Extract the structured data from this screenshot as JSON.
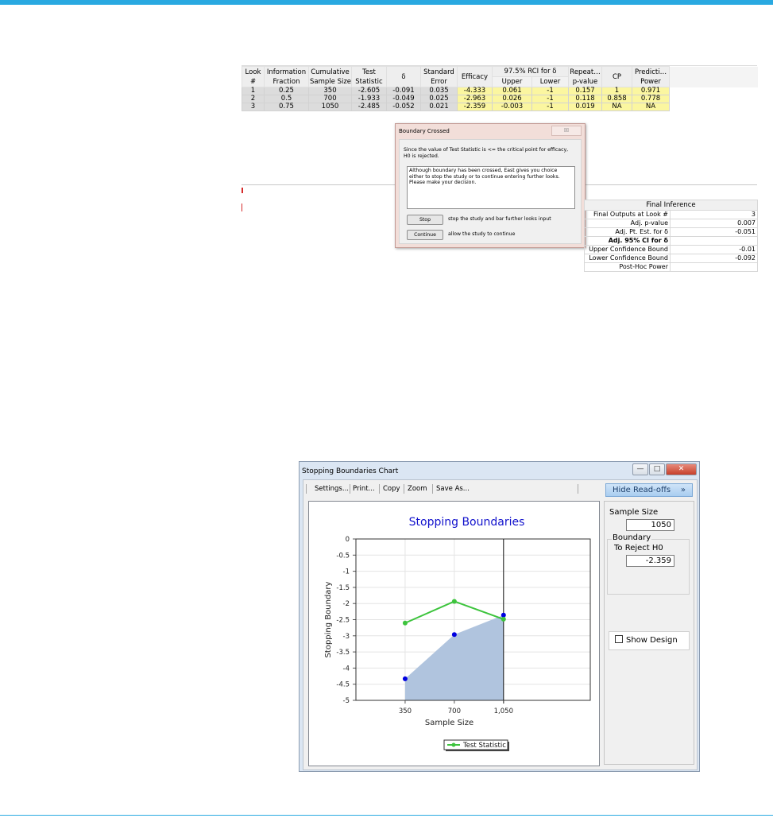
{
  "results": {
    "headers": [
      "Look #",
      "Information Fraction",
      "Cumulative Sample Size",
      "Test Statistic",
      "δ",
      "Standard Error",
      "Efficacy",
      "97.5% RCI for δ",
      "Repeat… p-value",
      "CP",
      "Predicti… Power"
    ],
    "header_lines": {
      "look": [
        "Look",
        "#"
      ],
      "info": [
        "Information",
        "Fraction"
      ],
      "cum": [
        "Cumulative",
        "Sample Size"
      ],
      "test": [
        "Test",
        "Statistic"
      ],
      "delta": "δ",
      "se": [
        "Standard",
        "Error"
      ],
      "eff": "Efficacy",
      "rci": "97.5% RCI for δ",
      "rci_upper": "Upper",
      "rci_lower": "Lower",
      "rep": [
        "Repeat…",
        "p-value"
      ],
      "cp": "CP",
      "pred": [
        "Predicti…",
        "Power"
      ]
    },
    "rows": [
      [
        "1",
        "0.25",
        "350",
        "-2.605",
        "-0.091",
        "0.035",
        "-4.333",
        "0.061",
        "-1",
        "0.157",
        "1",
        "0.971"
      ],
      [
        "2",
        "0.5",
        "700",
        "-1.933",
        "-0.049",
        "0.025",
        "-2.963",
        "0.026",
        "-1",
        "0.118",
        "0.858",
        "0.778"
      ],
      [
        "3",
        "0.75",
        "1050",
        "-2.485",
        "-0.052",
        "0.021",
        "-2.359",
        "-0.003",
        "-1",
        "0.019",
        "NA",
        "NA"
      ]
    ]
  },
  "dialog": {
    "title": "Boundary Crossed",
    "close": "☒",
    "message": "Since the value of Test Statistic is <= the critical point for efficacy, H0 is rejected.",
    "note": "Although boundary has been crossed, East gives you choice either to stop the study or to continue entering further looks. Please make your decision.",
    "stop_label": "Stop",
    "stop_desc": "stop the study and bar further looks input",
    "continue_label": "Continue",
    "continue_desc": "allow the study to continue"
  },
  "final_inference": {
    "title": "Final Inference",
    "rows": [
      {
        "label": "Final Outputs at Look #",
        "value": "3"
      },
      {
        "label": "Adj. p-value",
        "value": "0.007"
      },
      {
        "label": "Adj. Pt. Est. for δ",
        "value": "-0.051"
      },
      {
        "label": "Adj. 95% CI for δ",
        "value": ""
      },
      {
        "label": "Upper Confidence Bound",
        "value": "-0.01"
      },
      {
        "label": "Lower Confidence Bound",
        "value": "-0.092"
      },
      {
        "label": "Post-Hoc Power",
        "value": ""
      }
    ]
  },
  "chart_window": {
    "title": "Stopping Boundaries Chart",
    "toolbar": [
      "Settings...",
      "Print...",
      "Copy",
      "Zoom",
      "Save As..."
    ],
    "hide_readoffs": "Hide Read-offs",
    "hide_chevron": "»",
    "sample_size_label": "Sample Size",
    "sample_size_value": "1050",
    "boundary_group": "Boundary",
    "boundary_label": "To Reject H0",
    "boundary_value": "-2.359",
    "show_design": "Show Design",
    "minimize": "—",
    "maximize": "□",
    "close": "✕"
  },
  "chart_data": {
    "type": "line",
    "title": "Stopping Boundaries",
    "xlabel": "Sample Size",
    "ylabel": "Stopping Boundary",
    "x_ticks": [
      "350",
      "700",
      "1,050"
    ],
    "x_tick_values": [
      350,
      700,
      1050
    ],
    "y_ticks": [
      "0",
      "-0.5",
      "-1",
      "-1.5",
      "-2",
      "-2.5",
      "-3",
      "-3.5",
      "-4",
      "-4.5",
      "-5"
    ],
    "ylim": [
      -5,
      0
    ],
    "xlim": [
      0,
      1667
    ],
    "series": [
      {
        "name": "Test Statistic",
        "x": [
          350,
          700,
          1050
        ],
        "y": [
          -2.605,
          -1.933,
          -2.485
        ],
        "color": "#3dc43d"
      }
    ],
    "efficacy_boundary": {
      "x": [
        350,
        700,
        1050
      ],
      "y": [
        -4.333,
        -2.963,
        -2.359
      ],
      "color": "#0000e0",
      "fill": "#b0c4de"
    },
    "current_look_x": 1050,
    "legend": "bottom-center",
    "title_color": "#1111cc"
  }
}
